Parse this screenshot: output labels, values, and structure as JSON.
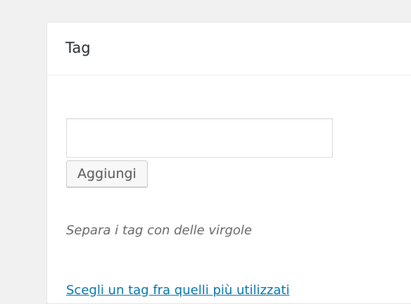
{
  "tagbox": {
    "title": "Tag",
    "input": {
      "value": "",
      "placeholder": ""
    },
    "add_button_label": "Aggiungi",
    "help_text": "Separa i tag con delle virgole",
    "choose_link": "Scegli un tag fra quelli più utilizzati"
  },
  "colors": {
    "background": "#f1f1f1",
    "panel": "#ffffff",
    "link": "#0073aa",
    "title": "#23282d",
    "help_text": "#666666"
  }
}
